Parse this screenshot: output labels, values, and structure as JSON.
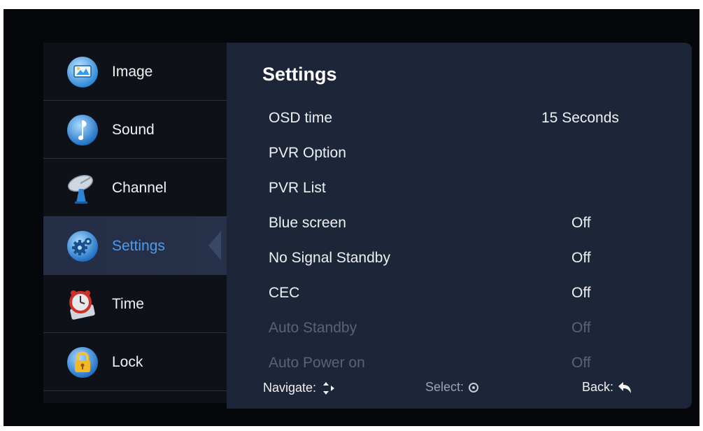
{
  "sidebar": {
    "items": [
      {
        "label": "Image",
        "icon": "image-icon"
      },
      {
        "label": "Sound",
        "icon": "music-note-icon"
      },
      {
        "label": "Channel",
        "icon": "satellite-dish-icon"
      },
      {
        "label": "Settings",
        "icon": "gear-icon",
        "active": true
      },
      {
        "label": "Time",
        "icon": "alarm-clock-icon"
      },
      {
        "label": "Lock",
        "icon": "padlock-icon"
      }
    ]
  },
  "panel": {
    "title": "Settings",
    "rows": [
      {
        "name": "OSD time",
        "value": "15 Seconds",
        "enabled": true
      },
      {
        "name": "PVR Option",
        "value": "",
        "enabled": true
      },
      {
        "name": "PVR List",
        "value": "",
        "enabled": true
      },
      {
        "name": "Blue screen",
        "value": "Off",
        "enabled": true
      },
      {
        "name": "No Signal Standby",
        "value": "Off",
        "enabled": true
      },
      {
        "name": "CEC",
        "value": "Off",
        "enabled": true
      },
      {
        "name": "Auto Standby",
        "value": "Off",
        "enabled": false
      },
      {
        "name": "Auto Power on",
        "value": "Off",
        "enabled": false
      }
    ]
  },
  "hints": {
    "navigate": "Navigate:",
    "select": "Select:",
    "back": "Back:"
  },
  "colors": {
    "accent": "#4a9df0",
    "panel_bg": "#1d2538",
    "sidebar_bg": "#0e1118",
    "disabled_text": "#5a6275"
  }
}
